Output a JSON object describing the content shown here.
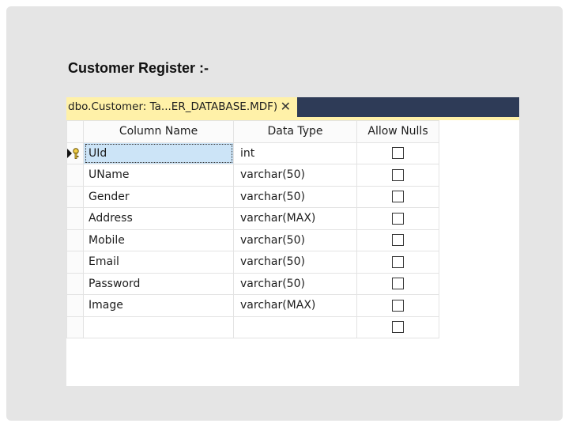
{
  "slide": {
    "title": "Customer Register :-"
  },
  "tab": {
    "label": "dbo.Customer: Ta...ER_DATABASE.MDF)",
    "close_glyph": "✕"
  },
  "grid": {
    "headers": {
      "column_name": "Column Name",
      "data_type": "Data Type",
      "allow_nulls": "Allow Nulls"
    },
    "rows": [
      {
        "name": "UId",
        "type": "int",
        "allow_nulls": false,
        "primary_key": true
      },
      {
        "name": "UName",
        "type": "varchar(50)",
        "allow_nulls": false
      },
      {
        "name": "Gender",
        "type": "varchar(50)",
        "allow_nulls": false
      },
      {
        "name": "Address",
        "type": "varchar(MAX)",
        "allow_nulls": false
      },
      {
        "name": "Mobile",
        "type": "varchar(50)",
        "allow_nulls": false
      },
      {
        "name": "Email",
        "type": "varchar(50)",
        "allow_nulls": false
      },
      {
        "name": "Password",
        "type": "varchar(50)",
        "allow_nulls": false
      },
      {
        "name": "Image",
        "type": "varchar(MAX)",
        "allow_nulls": false
      },
      {
        "name": "",
        "type": "",
        "allow_nulls": false
      }
    ]
  },
  "colors": {
    "tab_active": "#fff1a8",
    "tab_bar": "#2e3b57",
    "selection": "#cce4f7"
  },
  "icons": {
    "row_marker": "current-row-arrow-icon",
    "key": "primary-key-icon",
    "close": "close-icon"
  }
}
